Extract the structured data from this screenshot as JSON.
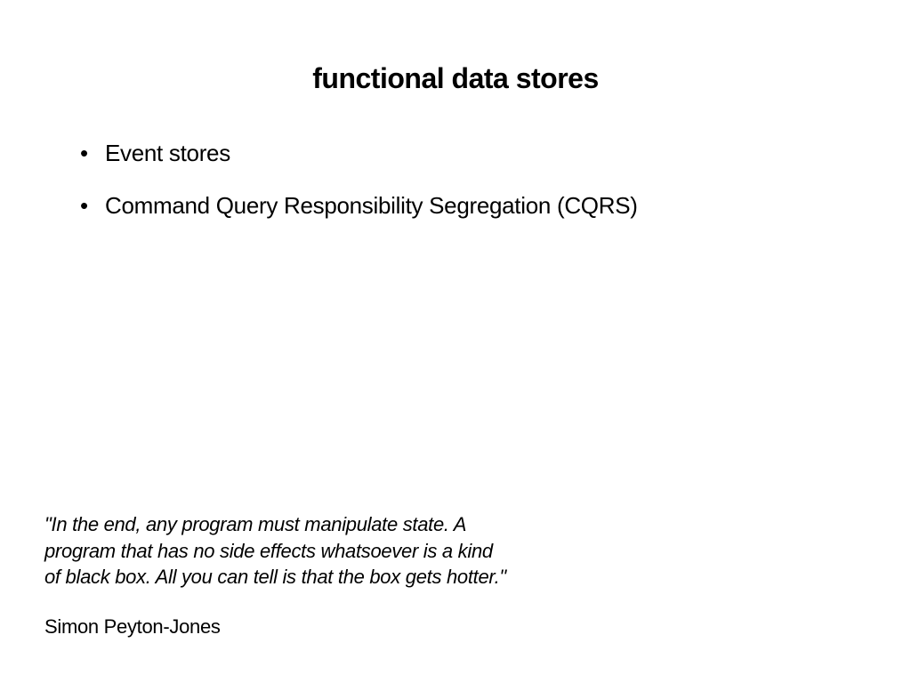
{
  "title": "functional data stores",
  "bullets": [
    "Event stores",
    "Command Query Responsibility Segregation (CQRS)"
  ],
  "quote": {
    "text": "\"In the end, any program must manipulate state. A program that has no side effects whatsoever is a kind of black box. All you can tell is that the box gets hotter.\"",
    "author": "Simon Peyton-Jones"
  }
}
